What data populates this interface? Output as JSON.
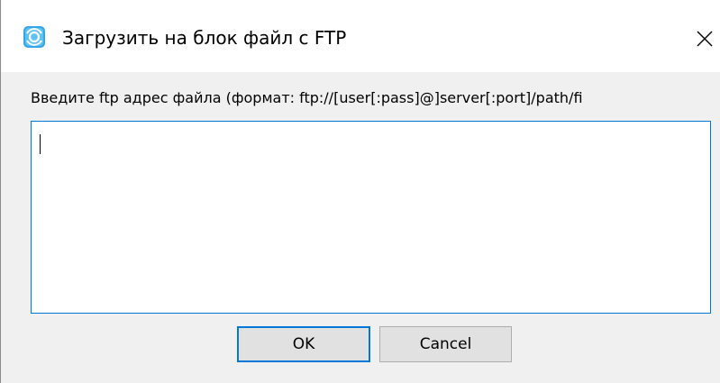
{
  "dialog": {
    "title": "Загрузить на блок файл с FTP",
    "app_icon": "network-drive-icon",
    "close_icon": "close-icon",
    "accent_color": "#0078d7"
  },
  "form": {
    "prompt": "Введите ftp адрес файла (формат: ftp://[user[:pass]@]server[:port]/path/fi",
    "url_value": ""
  },
  "buttons": {
    "ok_label": "OK",
    "cancel_label": "Cancel"
  }
}
